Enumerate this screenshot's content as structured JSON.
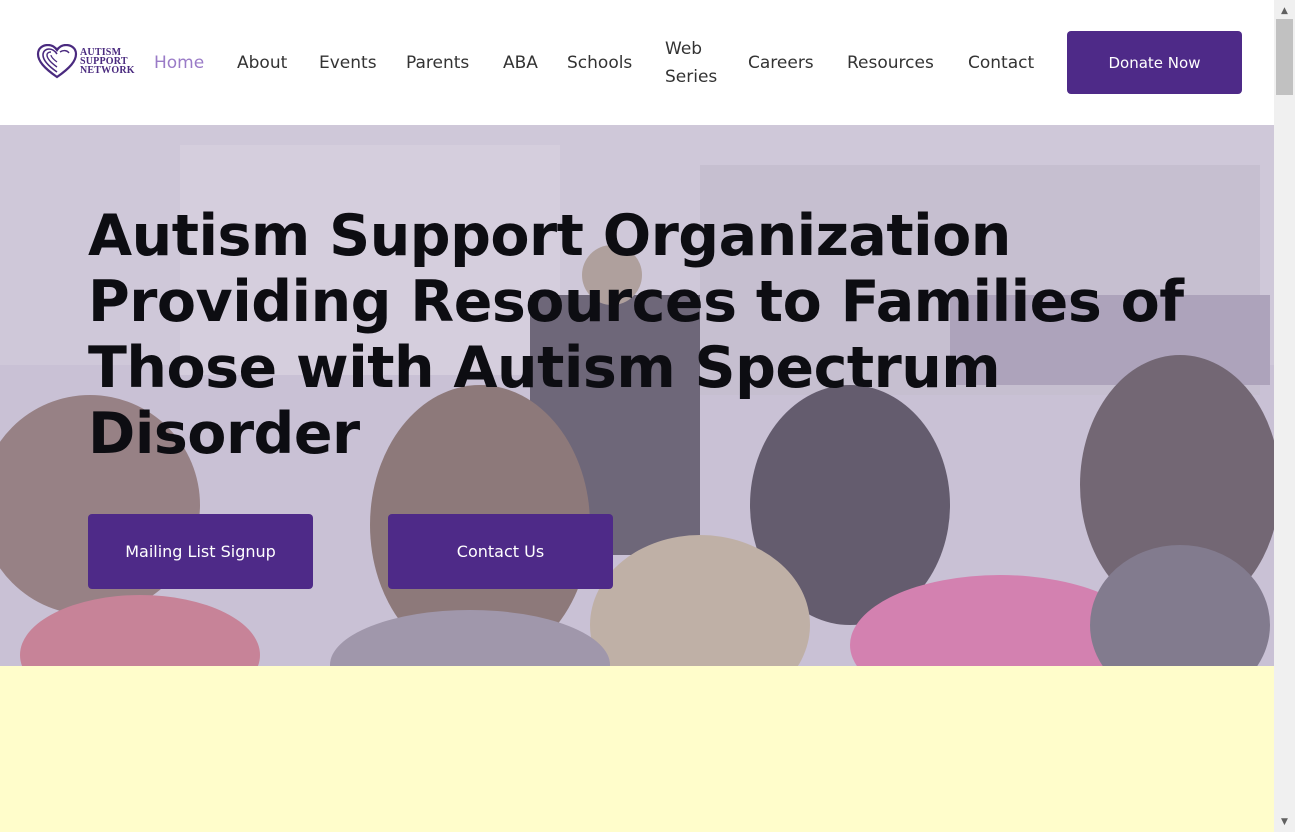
{
  "logo": {
    "line1": "AUTISM",
    "line2": "SUPPORT",
    "line3": "NETWORK",
    "color": "#4a2a7f"
  },
  "nav": {
    "items": [
      {
        "label": "Home",
        "active": true
      },
      {
        "label": "About"
      },
      {
        "label": "Events"
      },
      {
        "label": "Parents"
      },
      {
        "label": "ABA"
      },
      {
        "label": "Schools"
      },
      {
        "label": "Web Series"
      },
      {
        "label": "Careers"
      },
      {
        "label": "Resources"
      },
      {
        "label": "Contact"
      }
    ],
    "donate_label": "Donate Now"
  },
  "hero": {
    "title": "Autism Support Organization Providing Resources to Families of Those with Autism Spectrum Disorder",
    "buttons": [
      {
        "label": "Mailing List Signup"
      },
      {
        "label": "Contact Us"
      }
    ]
  },
  "colors": {
    "brand_purple": "#4e2a88",
    "active_nav": "#9a7bc7",
    "section_yellow": "#fffdcb"
  }
}
